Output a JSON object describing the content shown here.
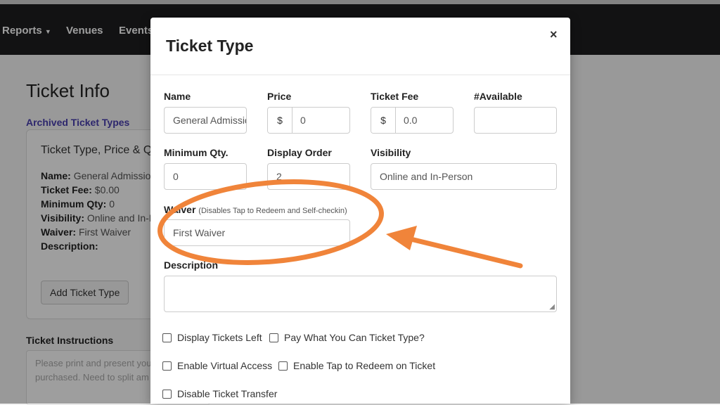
{
  "nav": {
    "items": [
      "Reports",
      "Venues",
      "Events"
    ]
  },
  "bg": {
    "title": "Ticket Info",
    "archived_link": "Archived Ticket Types",
    "card_title": "Ticket Type, Price & Qu",
    "rows": [
      {
        "label": "Name:",
        "value": "General Admission"
      },
      {
        "label": "Ticket Fee:",
        "value": "$0.00"
      },
      {
        "label": "Minimum Qty:",
        "value": "0"
      },
      {
        "label": "Visibility:",
        "value": "Online and In-Pe"
      },
      {
        "label": "Waiver:",
        "value": "First Waiver"
      },
      {
        "label": "Description:",
        "value": ""
      }
    ],
    "add_button": "Add Ticket Type",
    "instructions_label": "Ticket Instructions",
    "instructions_line1": "Please print and present you",
    "instructions_line2": "purchased. Need to split am"
  },
  "modal": {
    "title": "Ticket Type",
    "close": "×",
    "fields": {
      "name": {
        "label": "Name",
        "value": "General Admission"
      },
      "price": {
        "label": "Price",
        "prefix": "$",
        "value": "0"
      },
      "ticket_fee": {
        "label": "Ticket Fee",
        "prefix": "$",
        "value": "0.0"
      },
      "available": {
        "label": "#Available",
        "value": ""
      },
      "min_qty": {
        "label": "Minimum Qty.",
        "value": "0"
      },
      "display_order": {
        "label": "Display Order",
        "value": "2"
      },
      "visibility": {
        "label": "Visibility",
        "value": "Online and In-Person"
      },
      "waiver": {
        "label": "Waiver",
        "hint": "(Disables Tap to Redeem and Self-checkin)",
        "value": "First Waiver"
      },
      "description": {
        "label": "Description",
        "value": ""
      }
    },
    "checkboxes": [
      {
        "label": "Display Tickets Left",
        "checked": false
      },
      {
        "label": "Pay What You Can Ticket Type?",
        "checked": false
      },
      {
        "label": "Enable Virtual Access",
        "checked": false
      },
      {
        "label": "Enable Tap to Redeem on Ticket",
        "checked": false
      },
      {
        "label": "Disable Ticket Transfer",
        "checked": false
      }
    ]
  },
  "annotation_color": "#f0843a"
}
